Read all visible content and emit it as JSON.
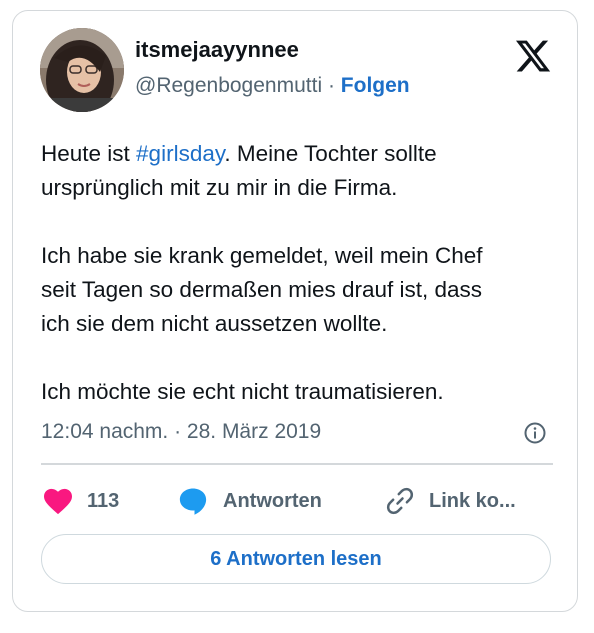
{
  "author": {
    "display_name": "itsmejaayynnee",
    "handle": "@Regenbogenmutti",
    "separator": "·",
    "follow_label": "Folgen"
  },
  "tweet": {
    "line1_before": "Heute ist ",
    "line1_hashtag": "#girlsday",
    "line1_after": ". Meine Tochter sollte",
    "line2": "ursprünglich mit zu mir in die Firma.",
    "line3": "Ich habe sie krank gemeldet, weil mein Chef",
    "line4": "seit Tagen so dermaßen mies drauf ist, dass",
    "line5": "ich sie dem nicht aussetzen wollte.",
    "line6": "Ich möchte sie echt nicht traumatisieren."
  },
  "meta": {
    "timestamp": "12:04 nachm. · 28. März 2019"
  },
  "actions": {
    "likes_count": "113",
    "reply_label": "Antworten",
    "link_label": "Link ko..."
  },
  "read_replies_label": "6 Antworten lesen",
  "icons": {
    "logo": "x-logo-icon",
    "like": "heart-icon",
    "reply": "speech-bubble-icon",
    "link": "link-icon",
    "info": "info-icon"
  },
  "colors": {
    "accent": "#1d6fc8",
    "heart": "#f91880",
    "reply_bubble": "#1d9bf0",
    "text": "#0f1419",
    "muted": "#536471",
    "border": "#d4d8db"
  }
}
